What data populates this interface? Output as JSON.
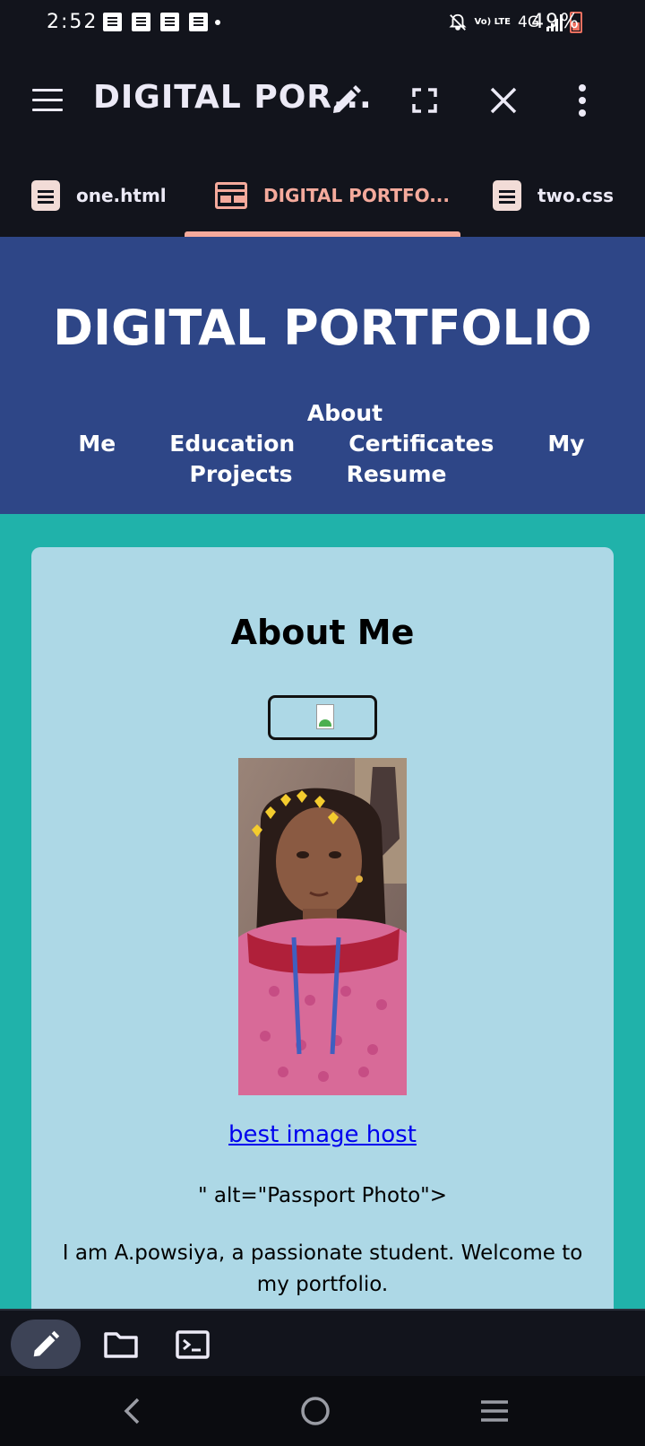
{
  "status_bar": {
    "time": "2:52",
    "network": "4G",
    "lte_label": "Vo) LTE",
    "battery": "49%",
    "icons": [
      "notification-icon",
      "notification-icon",
      "notification-icon",
      "notification-icon",
      "mute-icon",
      "signal-icon",
      "battery-icon"
    ]
  },
  "toolbar": {
    "title": "DIGITAL POR...",
    "icons": [
      "menu-icon",
      "edit-icon",
      "fullscreen-icon",
      "close-icon",
      "more-icon"
    ]
  },
  "tabs": [
    {
      "label": "one.html",
      "icon": "document-icon"
    },
    {
      "label": "DIGITAL PORTFO...",
      "icon": "web-preview-icon",
      "active": true
    },
    {
      "label": "two.css",
      "icon": "document-icon"
    }
  ],
  "site": {
    "title": "DIGITAL PORTFOLIO",
    "nav": [
      "About Me",
      "Education",
      "Certificates",
      "My Projects",
      "Resume"
    ]
  },
  "about": {
    "heading": "About Me",
    "link_text": "best image host",
    "alt_text": "\" alt=\"Passport Photo\">",
    "intro": "I am A.powsiya, a passionate student. Welcome to my portfolio."
  },
  "editor_bar": {
    "icons": [
      "edit-icon",
      "folder-icon",
      "terminal-icon"
    ]
  },
  "system_nav": {
    "icons": [
      "back-icon",
      "home-icon",
      "recents-icon"
    ]
  },
  "colors": {
    "app_bg": "#12141c",
    "accent": "#f5aa9c",
    "site_header": "#2e4687",
    "page_bg": "#20b2aa",
    "card_bg": "#add8e6",
    "link": "#0000ee"
  }
}
